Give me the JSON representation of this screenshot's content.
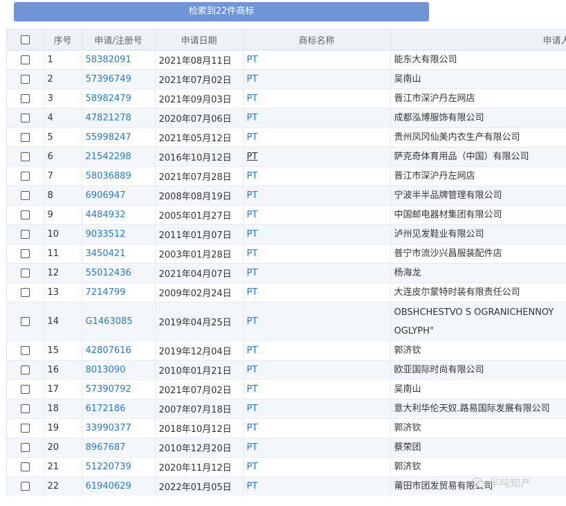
{
  "result_bar": {
    "label": "检索到22件商标"
  },
  "columns": {
    "index": "序号",
    "reg_no": "申请/注册号",
    "date": "申请日期",
    "name": "商标名称",
    "applicant": "申请人名称"
  },
  "rows": [
    {
      "idx": "1",
      "reg": "58382091",
      "date": "2021年08月11日",
      "name": "PT",
      "app": "能东大有限公司"
    },
    {
      "idx": "2",
      "reg": "57396749",
      "date": "2021年07月02日",
      "name": "PT",
      "app": "吴南山"
    },
    {
      "idx": "3",
      "reg": "58982479",
      "date": "2021年09月03日",
      "name": "PT",
      "app": "晋江市深沪丹左网店"
    },
    {
      "idx": "4",
      "reg": "47821278",
      "date": "2020年07月06日",
      "name": "PT",
      "app": "成都泓博服饰有限公司"
    },
    {
      "idx": "5",
      "reg": "55998247",
      "date": "2021年05月12日",
      "name": "PT",
      "app": "贵州凤冈仙美内衣生产有限公司"
    },
    {
      "idx": "6",
      "reg": "21542298",
      "date": "2016年10月12日",
      "name": "PT",
      "app": "萨克奇体育用品（中国）有限公司"
    },
    {
      "idx": "7",
      "reg": "58036889",
      "date": "2021年07月28日",
      "name": "PT",
      "app": "晋江市深沪丹左网店"
    },
    {
      "idx": "8",
      "reg": "6906947",
      "date": "2008年08月19日",
      "name": "PT",
      "app": "宁波半半品牌管理有限公司"
    },
    {
      "idx": "9",
      "reg": "4484932",
      "date": "2005年01月27日",
      "name": "PT",
      "app": "中国邮电器材集团有限公司"
    },
    {
      "idx": "10",
      "reg": "9033512",
      "date": "2011年01月07日",
      "name": "PT",
      "app": "泸州见发鞋业有限公司"
    },
    {
      "idx": "11",
      "reg": "3450421",
      "date": "2003年01月28日",
      "name": "PT",
      "app": "普宁市流沙兴昌服装配件店"
    },
    {
      "idx": "12",
      "reg": "55012436",
      "date": "2021年04月07日",
      "name": "PT",
      "app": "杨海龙"
    },
    {
      "idx": "13",
      "reg": "7214799",
      "date": "2009年02月24日",
      "name": "PT",
      "app": "大连皮尔蒙特时装有限责任公司"
    },
    {
      "idx": "14",
      "reg": "G1463085",
      "date": "2019年04月25日",
      "name": "PT",
      "app": "OBSHCHESTVO S OGRANICHENNOY OGLYPH\""
    },
    {
      "idx": "15",
      "reg": "42807616",
      "date": "2019年12月04日",
      "name": "PT",
      "app": "郭济钦"
    },
    {
      "idx": "16",
      "reg": "8013090",
      "date": "2010年01月21日",
      "name": "PT",
      "app": "欧亚国际时尚有限公司"
    },
    {
      "idx": "17",
      "reg": "57390792",
      "date": "2021年07月02日",
      "name": "PT",
      "app": "吴南山"
    },
    {
      "idx": "18",
      "reg": "6172186",
      "date": "2007年07月18日",
      "name": "PT",
      "app": "意大利华伦天奴.路易国际发展有限公司"
    },
    {
      "idx": "19",
      "reg": "33990377",
      "date": "2018年10月12日",
      "name": "PT",
      "app": "郭济钦"
    },
    {
      "idx": "20",
      "reg": "8967687",
      "date": "2010年12月20日",
      "name": "PT",
      "app": "蔡荣团"
    },
    {
      "idx": "21",
      "reg": "51220739",
      "date": "2020年11月12日",
      "name": "PT",
      "app": "郭济钦"
    },
    {
      "idx": "22",
      "reg": "61940629",
      "date": "2022年01月05日",
      "name": "PT",
      "app": "莆田市团发贸易有限公司"
    }
  ],
  "hovered_name_row": "6",
  "watermark": {
    "text": "半吨知产",
    "icon": "wechat-icon"
  },
  "colors": {
    "link": "#2a7ac6",
    "result_bar": "#6f95d6",
    "header_bg": "#eef2f7"
  }
}
